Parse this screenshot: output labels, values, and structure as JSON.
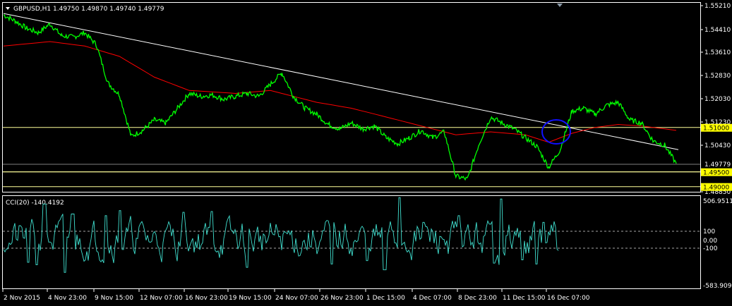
{
  "main_panel": {
    "header": "GBPUSD,H1  1.49750 1.49870 1.49740 1.49779",
    "price_scale": [
      "1.55210",
      "1.54410",
      "1.53610",
      "1.52830",
      "1.52030",
      "1.51230",
      "1.50430",
      "1.48850"
    ],
    "current_price": "1.49779",
    "levels": [
      {
        "value": 1.51,
        "label": "1.51000"
      },
      {
        "value": 1.495,
        "label": "1.49500"
      },
      {
        "value": 1.49,
        "label": "1.49000"
      }
    ],
    "colors": {
      "price": "#00ff00",
      "ma": "#ff0000",
      "trendline": "#ffffff",
      "levels": "#ffff99",
      "circle": "#0000ff",
      "tag_bg": "#ffff00"
    }
  },
  "cci_panel": {
    "header": "CCI(20) -140.4192",
    "scale": [
      "506.9511",
      "100",
      "0.00",
      "-100",
      "-583.909"
    ],
    "color": "#40e0d0"
  },
  "time_axis": [
    "2 Nov 2015",
    "4 Nov 23:00",
    "9 Nov 15:00",
    "12 Nov 07:00",
    "16 Nov 23:00",
    "19 Nov 15:00",
    "24 Nov 07:00",
    "26 Nov 23:00",
    "1 Dec 15:00",
    "4 Dec 07:00",
    "8 Dec 23:00",
    "11 Dec 15:00",
    "16 Dec 07:00"
  ],
  "chart_data": {
    "type": "line",
    "title": "GBPUSD,H1",
    "x": [
      "2 Nov 2015",
      "4 Nov 23:00",
      "9 Nov 15:00",
      "12 Nov 07:00",
      "16 Nov 23:00",
      "19 Nov 15:00",
      "24 Nov 07:00",
      "26 Nov 23:00",
      "1 Dec 15:00",
      "4 Dec 07:00",
      "8 Dec 23:00",
      "11 Dec 15:00",
      "16 Dec 07:00"
    ],
    "ylim": [
      1.4885,
      1.5521
    ],
    "price_anchors": [
      [
        0,
        1.548
      ],
      [
        1,
        1.546
      ],
      [
        2,
        1.5435
      ],
      [
        3,
        1.542
      ],
      [
        4,
        1.545
      ],
      [
        5,
        1.541
      ],
      [
        6,
        1.5405
      ],
      [
        7,
        1.542
      ],
      [
        8,
        1.538
      ],
      [
        9,
        1.525
      ],
      [
        10,
        1.521
      ],
      [
        11,
        1.507
      ],
      [
        12,
        1.509
      ],
      [
        13,
        1.5125
      ],
      [
        14,
        1.5115
      ],
      [
        15,
        1.5165
      ],
      [
        16,
        1.5215
      ],
      [
        17,
        1.5205
      ],
      [
        18,
        1.521
      ],
      [
        19,
        1.5195
      ],
      [
        20,
        1.5205
      ],
      [
        21,
        1.5215
      ],
      [
        22,
        1.5205
      ],
      [
        23,
        1.5245
      ],
      [
        24,
        1.5285
      ],
      [
        25,
        1.5205
      ],
      [
        26,
        1.5165
      ],
      [
        27,
        1.5145
      ],
      [
        28,
        1.511
      ],
      [
        29,
        1.5095
      ],
      [
        30,
        1.5115
      ],
      [
        31,
        1.5095
      ],
      [
        32,
        1.5105
      ],
      [
        33,
        1.5065
      ],
      [
        34,
        1.5045
      ],
      [
        35,
        1.5065
      ],
      [
        36,
        1.509
      ],
      [
        37,
        1.5065
      ],
      [
        38,
        1.5085
      ],
      [
        39,
        1.4935
      ],
      [
        40,
        1.4925
      ],
      [
        41,
        1.5045
      ],
      [
        42,
        1.5135
      ],
      [
        43,
        1.5115
      ],
      [
        44,
        1.5095
      ],
      [
        45,
        1.5065
      ],
      [
        46,
        1.5035
      ],
      [
        47,
        1.4965
      ],
      [
        48,
        1.5025
      ],
      [
        49,
        1.5155
      ],
      [
        50,
        1.5165
      ],
      [
        51,
        1.5145
      ],
      [
        52,
        1.5175
      ],
      [
        53,
        1.5185
      ],
      [
        54,
        1.5125
      ],
      [
        55,
        1.5115
      ],
      [
        56,
        1.5055
      ],
      [
        57,
        1.504
      ],
      [
        58,
        1.49779
      ]
    ],
    "ma_anchors": [
      [
        0,
        1.5375
      ],
      [
        4,
        1.539
      ],
      [
        7,
        1.5375
      ],
      [
        10,
        1.534
      ],
      [
        13,
        1.527
      ],
      [
        16,
        1.5225
      ],
      [
        20,
        1.5215
      ],
      [
        23,
        1.5225
      ],
      [
        27,
        1.5185
      ],
      [
        30,
        1.5165
      ],
      [
        33,
        1.5135
      ],
      [
        36,
        1.5105
      ],
      [
        39,
        1.5075
      ],
      [
        42,
        1.5085
      ],
      [
        45,
        1.5075
      ],
      [
        47,
        1.505
      ],
      [
        49,
        1.508
      ],
      [
        51,
        1.51
      ],
      [
        53,
        1.511
      ],
      [
        55,
        1.5105
      ],
      [
        57,
        1.5095
      ],
      [
        58,
        1.509
      ]
    ],
    "trendline": {
      "start": 1.5485,
      "end": 1.5025
    },
    "cci_ylim": [
      -583.909,
      506.9511
    ]
  }
}
